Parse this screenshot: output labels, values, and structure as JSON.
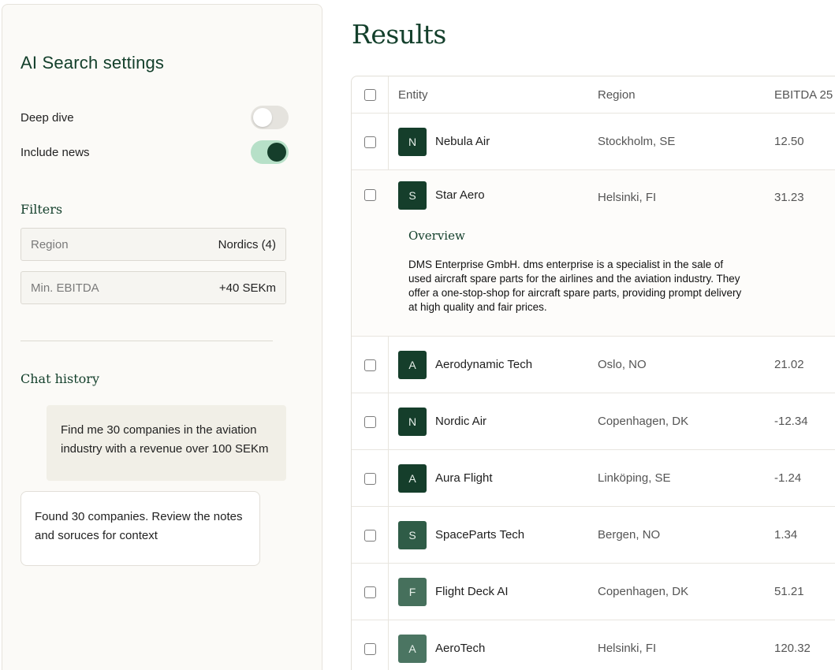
{
  "sidebar": {
    "title": "AI Search settings",
    "toggles": [
      {
        "label": "Deep dive",
        "on": false
      },
      {
        "label": "Include news",
        "on": true
      }
    ],
    "filters_heading": "Filters",
    "filters": [
      {
        "label": "Region",
        "value": "Nordics (4)"
      },
      {
        "label": "Min. EBITDA",
        "value": "+40 SEKm"
      }
    ],
    "chat_heading": "Chat history",
    "chat": {
      "user_message": "Find me 30 companies in the aviation industry with a revenue over 100 SEKm",
      "bot_message": "Found 30 companies. Review the notes and soruces for context"
    }
  },
  "main": {
    "title": "Results",
    "columns": [
      "Entity",
      "Region",
      "EBITDA 25"
    ],
    "rows": [
      {
        "initial": "N",
        "name": "Nebula Air",
        "region": "Stockholm, SE",
        "ebitda": "12.50",
        "avatar_color": "#153e2b"
      },
      {
        "initial": "S",
        "name": "Star Aero",
        "region": "Helsinki, FI",
        "ebitda": "31.23",
        "avatar_color": "#153e2b",
        "overview_title": "Overview",
        "overview_text": "DMS Enterprise GmbH. dms enterprise is a specialist in the sale of used aircraft spare parts for the airlines and the aviation industry. They offer a one-stop-shop for aircraft spare parts, providing prompt delivery at high quality and fair prices."
      },
      {
        "initial": "A",
        "name": "Aerodynamic Tech",
        "region": "Oslo, NO",
        "ebitda": "21.02",
        "avatar_color": "#153e2b"
      },
      {
        "initial": "N",
        "name": "Nordic Air",
        "region": "Copenhagen, DK",
        "ebitda": "-12.34",
        "avatar_color": "#153e2b"
      },
      {
        "initial": "A",
        "name": "Aura Flight",
        "region": "Linköping, SE",
        "ebitda": "-1.24",
        "avatar_color": "#153e2b"
      },
      {
        "initial": "S",
        "name": "SpaceParts Tech",
        "region": "Bergen, NO",
        "ebitda": "1.34",
        "avatar_color": "#2f5c47"
      },
      {
        "initial": "F",
        "name": "Flight Deck AI",
        "region": "Copenhagen, DK",
        "ebitda": "51.21",
        "avatar_color": "#46705c"
      },
      {
        "initial": "A",
        "name": "AeroTech",
        "region": "Helsinki, FI",
        "ebitda": "120.32",
        "avatar_color": "#4b7562"
      }
    ]
  }
}
